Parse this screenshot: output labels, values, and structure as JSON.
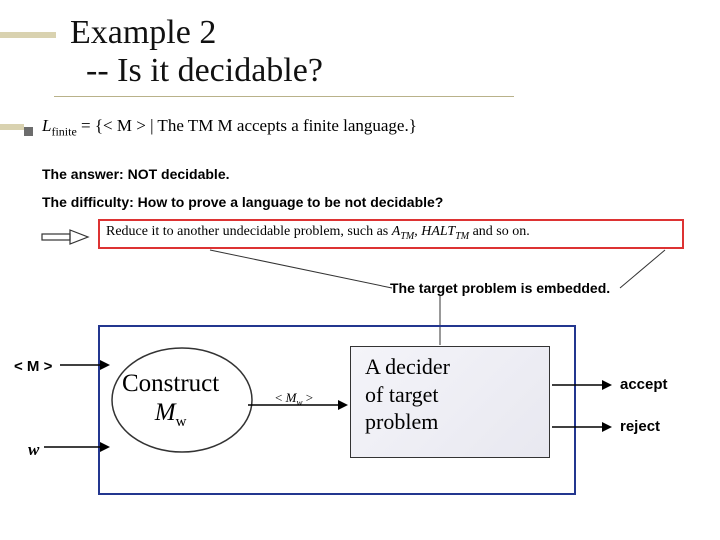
{
  "title": {
    "line1": "Example 2",
    "line2": "-- Is it decidable?"
  },
  "formula": {
    "lhs_prefix": "L",
    "lhs_sub": "finite",
    "body": " = {< M > | The TM M accepts a finite language.}"
  },
  "answer_line": "The answer:  NOT decidable.",
  "difficulty_line": "The difficulty: How to prove a language to be not decidable?",
  "reduction": {
    "prefix": "Reduce it to another undecidable problem, such as ",
    "a": "A",
    "a_sub": "TM",
    "comma": ", ",
    "halt": "HALT",
    "halt_sub": "TM",
    "tail": " and so on."
  },
  "target_note": "The target problem is embedded.",
  "inputs": {
    "m": "< M >",
    "w": "w"
  },
  "construct": {
    "line1": "Construct",
    "M": "M",
    "sub": "w"
  },
  "mid_label": {
    "open": "< ",
    "M": "M",
    "sub": "w",
    "close": " >"
  },
  "decider": {
    "l1": "A decider",
    "l2": "of target",
    "l3": "problem"
  },
  "outputs": {
    "accept": "accept",
    "reject": "reject"
  }
}
